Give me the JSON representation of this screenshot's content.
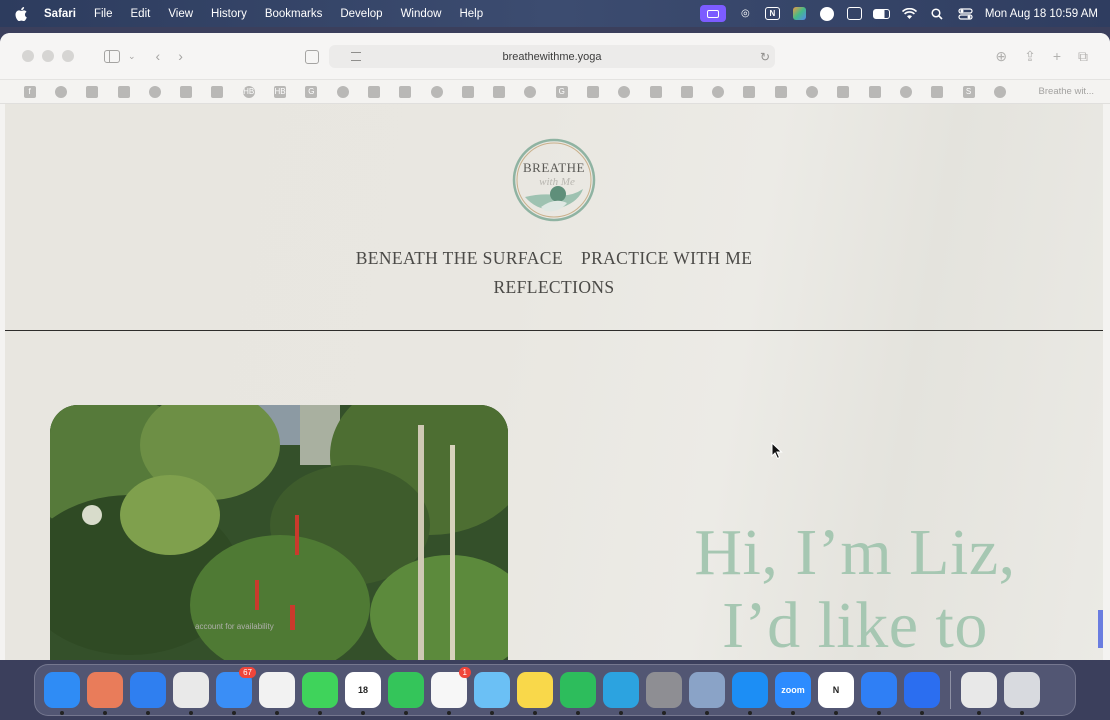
{
  "menubar": {
    "app_name": "Safari",
    "menus": [
      "File",
      "Edit",
      "View",
      "History",
      "Bookmarks",
      "Develop",
      "Window",
      "Help"
    ],
    "status_icons": [
      "screen-mirroring-icon",
      "audio-icon",
      "notion-n-icon",
      "app-icon",
      "vpn-icon",
      "window-icon",
      "battery-icon",
      "wifi-icon",
      "search-icon",
      "control-center-icon"
    ],
    "clock": "Mon Aug 18  10:59 AM"
  },
  "browser": {
    "url": "breathewithme.yoga",
    "favorites_last_label": "Breathe wit...",
    "favorites": [
      "f",
      "",
      "",
      "",
      "",
      "",
      "",
      "HB",
      "HB",
      "G",
      "",
      "",
      "",
      "",
      "",
      "",
      "",
      "G",
      "",
      "",
      "",
      "",
      "",
      "",
      "",
      "",
      "",
      "",
      "",
      "",
      "S",
      ""
    ]
  },
  "site": {
    "logo_text_top": "BREATHE",
    "logo_text_script": "with Me",
    "nav": {
      "item1": "BENEATH THE SURFACE",
      "item2": "PRACTICE WITH ME",
      "item3": "REFLECTIONS"
    },
    "hero_line1": "Hi, I’m Liz,",
    "hero_line2": "I’d like to",
    "caption": "account for availability"
  },
  "dock": {
    "apps": [
      {
        "name": "finder-icon",
        "color": "#2f8cf5"
      },
      {
        "name": "launchpad-icon",
        "color": "#e97c5a"
      },
      {
        "name": "safari-icon",
        "color": "#2f7ff0"
      },
      {
        "name": "chrome-icon",
        "color": "#e9e9e9"
      },
      {
        "name": "mail-icon",
        "color": "#3a8ef6",
        "badge": "67"
      },
      {
        "name": "photos-icon",
        "color": "#f2f2f2"
      },
      {
        "name": "messages-icon",
        "color": "#3fd35b"
      },
      {
        "name": "calendar-icon",
        "color": "#ffffff",
        "label": "18"
      },
      {
        "name": "facetime-icon",
        "color": "#34c55a"
      },
      {
        "name": "reminders-icon",
        "color": "#f7f7f7",
        "badge": "1"
      },
      {
        "name": "maps-icon",
        "color": "#6bc0f5"
      },
      {
        "name": "notes-icon",
        "color": "#f9d84a"
      },
      {
        "name": "numbers-icon",
        "color": "#2dbd5c"
      },
      {
        "name": "telegram-icon",
        "color": "#2ca3e0"
      },
      {
        "name": "system-settings-icon",
        "color": "#8e8e93"
      },
      {
        "name": "preview-icon",
        "color": "#8aa3c7"
      },
      {
        "name": "app-store-icon",
        "color": "#1c8ef5"
      },
      {
        "name": "zoom-icon",
        "color": "#2d8cff",
        "label": "zoom"
      },
      {
        "name": "notion-icon",
        "color": "#ffffff",
        "label": "N"
      },
      {
        "name": "messenger-icon",
        "color": "#2f7ff5"
      },
      {
        "name": "docs-icon",
        "color": "#2b6ef0"
      },
      {
        "name": "file-icon",
        "color": "#e8e8e8"
      },
      {
        "name": "trash-icon",
        "color": "#d8dadf"
      }
    ]
  }
}
